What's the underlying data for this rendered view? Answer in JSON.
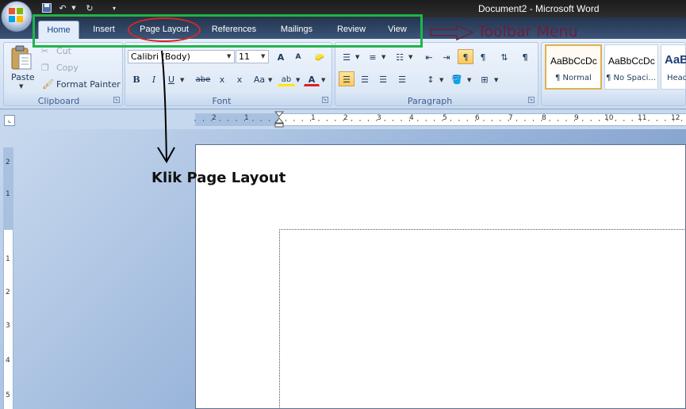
{
  "window": {
    "title": "Document2 - Microsoft Word"
  },
  "tabs": [
    {
      "label": "Home",
      "active": true
    },
    {
      "label": "Insert"
    },
    {
      "label": "Page Layout"
    },
    {
      "label": "References"
    },
    {
      "label": "Mailings"
    },
    {
      "label": "Review"
    },
    {
      "label": "View"
    }
  ],
  "clipboard": {
    "group_label": "Clipboard",
    "paste_label": "Paste",
    "cut_label": "Cut",
    "copy_label": "Copy",
    "format_painter_label": "Format Painter"
  },
  "font": {
    "group_label": "Font",
    "font_name": "Calibri (Body)",
    "font_size": "11",
    "grow_label": "A",
    "shrink_label": "A",
    "bold": "B",
    "italic": "I",
    "underline": "U",
    "strike": "abe",
    "subscript": "x",
    "superscript": "x",
    "change_case": "Aa",
    "highlight": "ab",
    "font_color": "A"
  },
  "paragraph": {
    "group_label": "Paragraph"
  },
  "styles": [
    {
      "sample": "AaBbCcDc",
      "name": "¶ Normal",
      "selected": true
    },
    {
      "sample": "AaBbCcDc",
      "name": "¶ No Spaci..."
    },
    {
      "sample": "AaB",
      "name": "Head"
    }
  ],
  "ruler": {
    "numbers": [
      "2",
      "1",
      "1",
      "2",
      "3",
      "4",
      "5",
      "6",
      "7",
      "8",
      "9",
      "10",
      "11",
      "12"
    ],
    "vertical_numbers": [
      "2",
      "1",
      "1",
      "2",
      "3",
      "4",
      "5"
    ]
  },
  "annotations": {
    "toolbar_menu": "Toolbar Menu",
    "klik_page_layout": "Klik Page Layout"
  },
  "colors": {
    "highlight_box": "#1fb54a",
    "ellipse": "#d22a2a",
    "toolbar_label": "#6b1f3b"
  },
  "icons": {
    "office_button": "office-logo-icon",
    "save": "save-icon",
    "undo": "undo-icon",
    "redo": "redo-icon"
  }
}
